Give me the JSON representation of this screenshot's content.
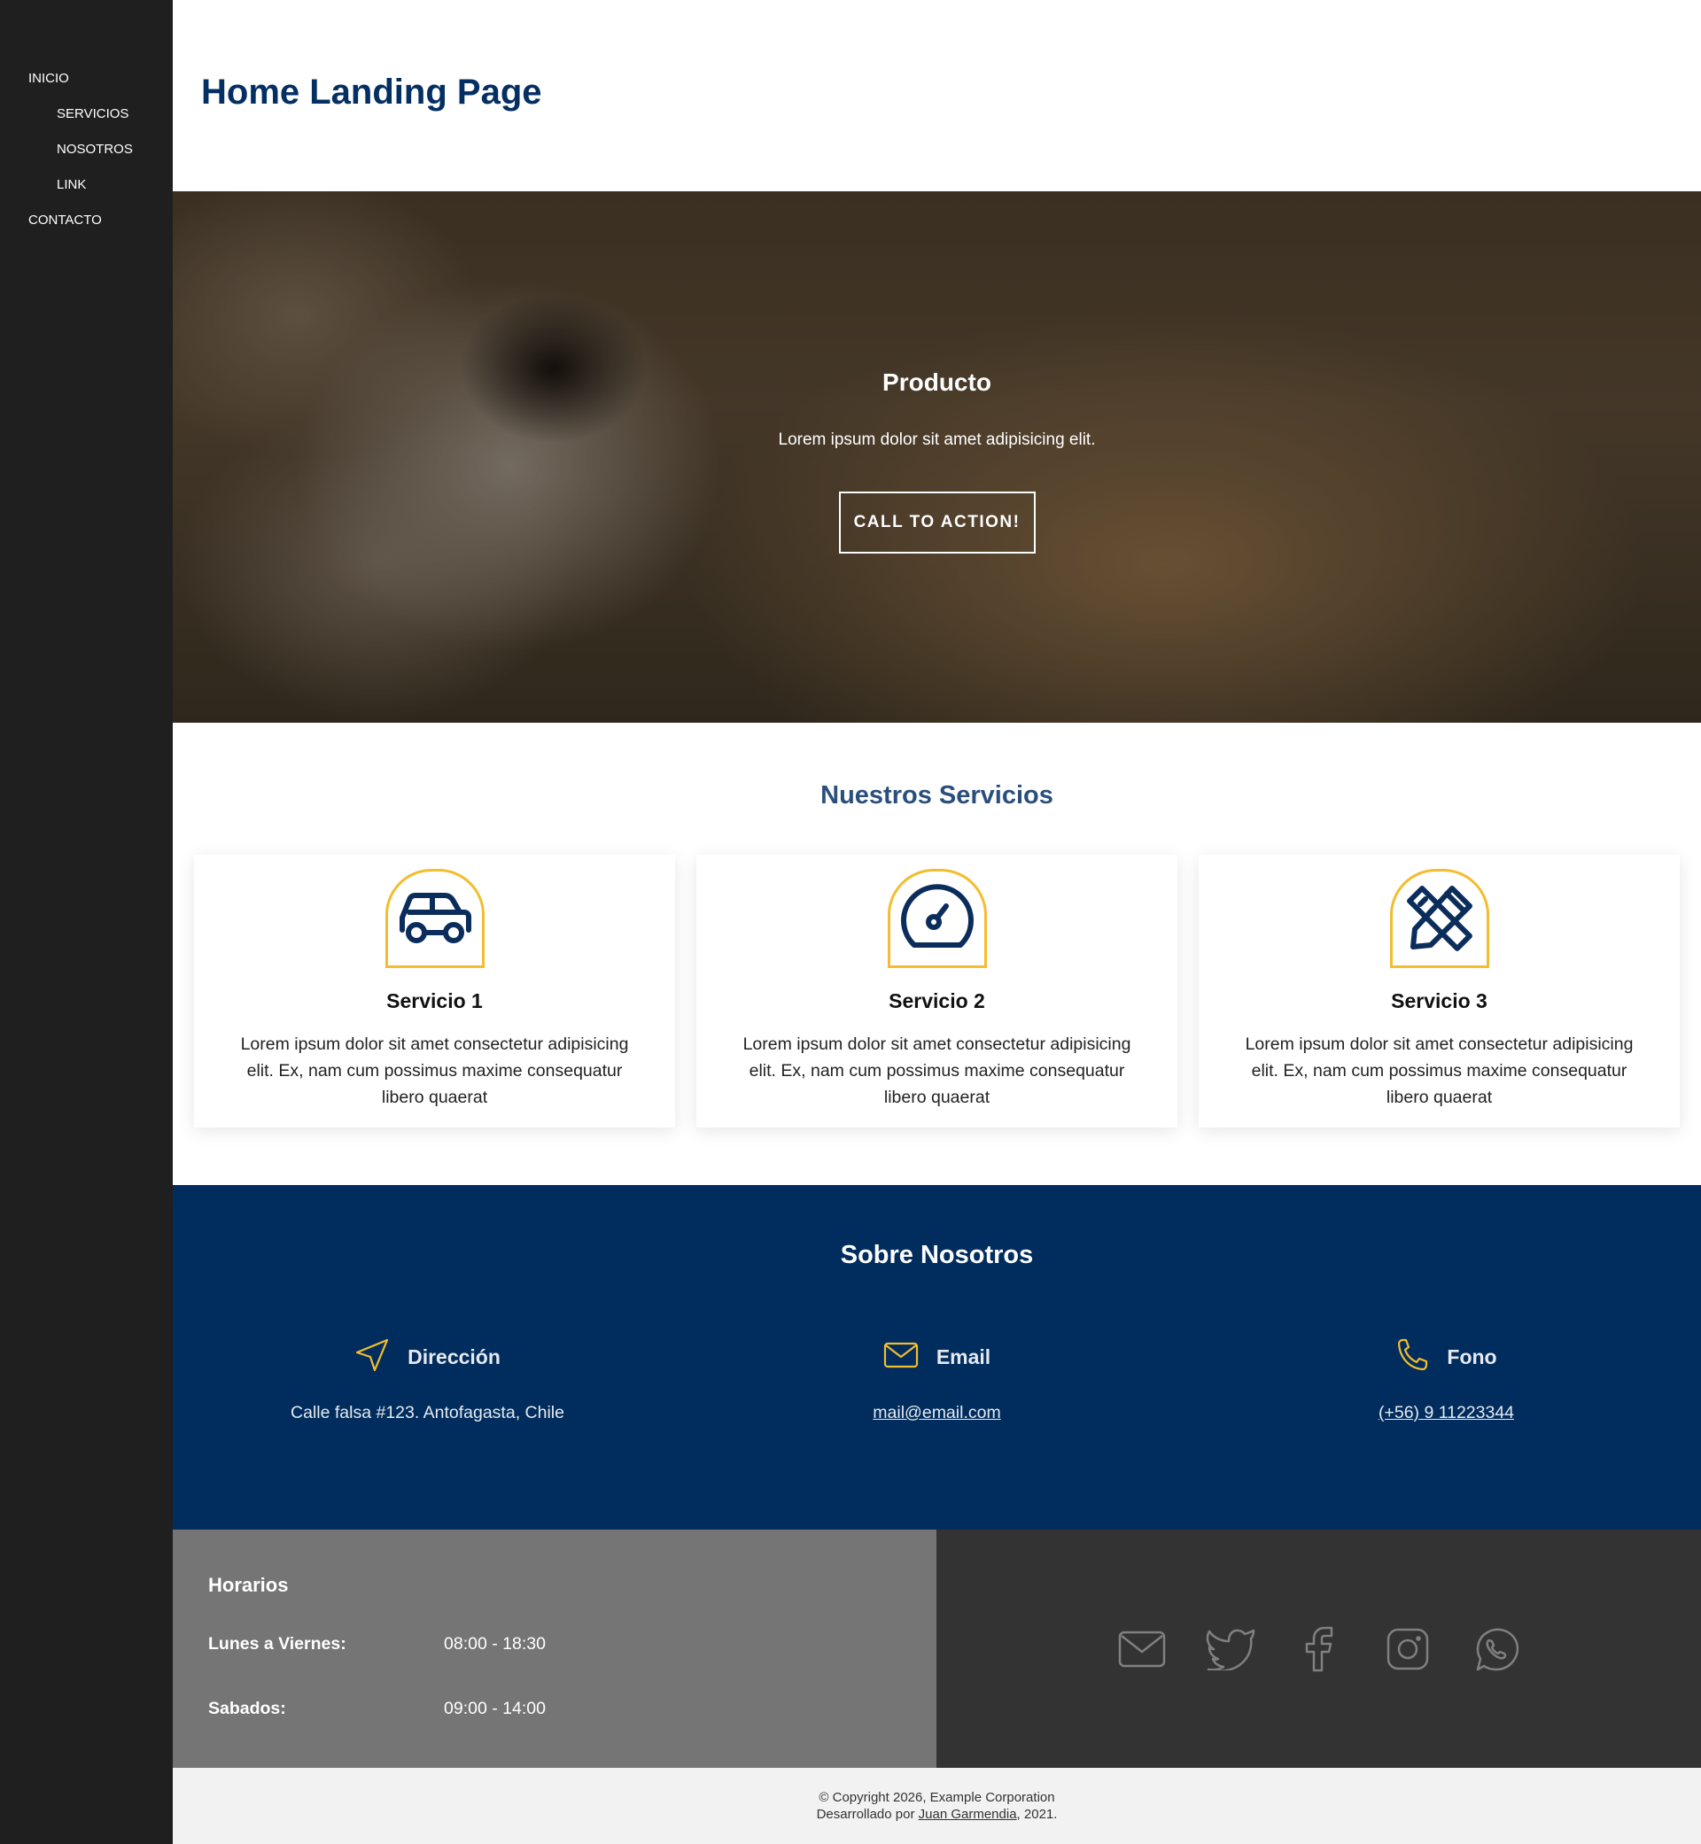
{
  "sidebar": {
    "items": [
      {
        "label": "INICIO"
      },
      {
        "label": "SERVICIOS"
      },
      {
        "label": "NOSOTROS"
      },
      {
        "label": "LINK"
      },
      {
        "label": "CONTACTO"
      }
    ]
  },
  "header": {
    "title": "Home Landing Page"
  },
  "hero": {
    "title": "Producto",
    "text": "Lorem ipsum dolor sit amet adipisicing elit.",
    "cta_label": "CALL TO ACTION!"
  },
  "services": {
    "title": "Nuestros Servicios",
    "cards": [
      {
        "icon": "car-icon",
        "title": "Servicio 1",
        "text": "Lorem ipsum dolor sit amet consectetur adipisicing elit. Ex, nam cum possimus maxime consequatur libero quaerat"
      },
      {
        "icon": "gauge-icon",
        "title": "Servicio 2",
        "text": "Lorem ipsum dolor sit amet consectetur adipisicing elit. Ex, nam cum possimus maxime consequatur libero quaerat"
      },
      {
        "icon": "pencil-ruler-icon",
        "title": "Servicio 3",
        "text": "Lorem ipsum dolor sit amet consectetur adipisicing elit. Ex, nam cum possimus maxime consequatur libero quaerat"
      }
    ]
  },
  "about": {
    "title": "Sobre Nosotros",
    "address": {
      "icon": "navigation-arrow-icon",
      "label": "Dirección",
      "value": "Calle falsa #123. Antofagasta, Chile"
    },
    "email": {
      "icon": "envelope-icon",
      "label": "Email",
      "value": "mail@email.com"
    },
    "phone": {
      "icon": "phone-icon",
      "label": "Fono",
      "value": "(+56) 9 11223344"
    }
  },
  "hours": {
    "title": "Horarios",
    "rows": [
      {
        "day": "Lunes a Viernes:",
        "time": "08:00 - 18:30"
      },
      {
        "day": "Sabados:",
        "time": "09:00 - 14:00"
      }
    ]
  },
  "social": {
    "icons": [
      "mail-icon",
      "twitter-icon",
      "facebook-icon",
      "instagram-icon",
      "whatsapp-icon"
    ]
  },
  "footer": {
    "copyright": "© Copyright 2026, Example Corporation",
    "developed_prefix": "Desarrollado por ",
    "developer": "Juan Garmendia",
    "developed_suffix": ", 2021."
  },
  "colors": {
    "sidebar_bg": "#1f1f1f",
    "primary_navy": "#002d5d",
    "title_blue": "#042f62",
    "accent_yellow": "#f3bd2f",
    "hours_bg": "#757575",
    "social_bg": "#333333",
    "footer_bg": "#f2f2f2"
  }
}
